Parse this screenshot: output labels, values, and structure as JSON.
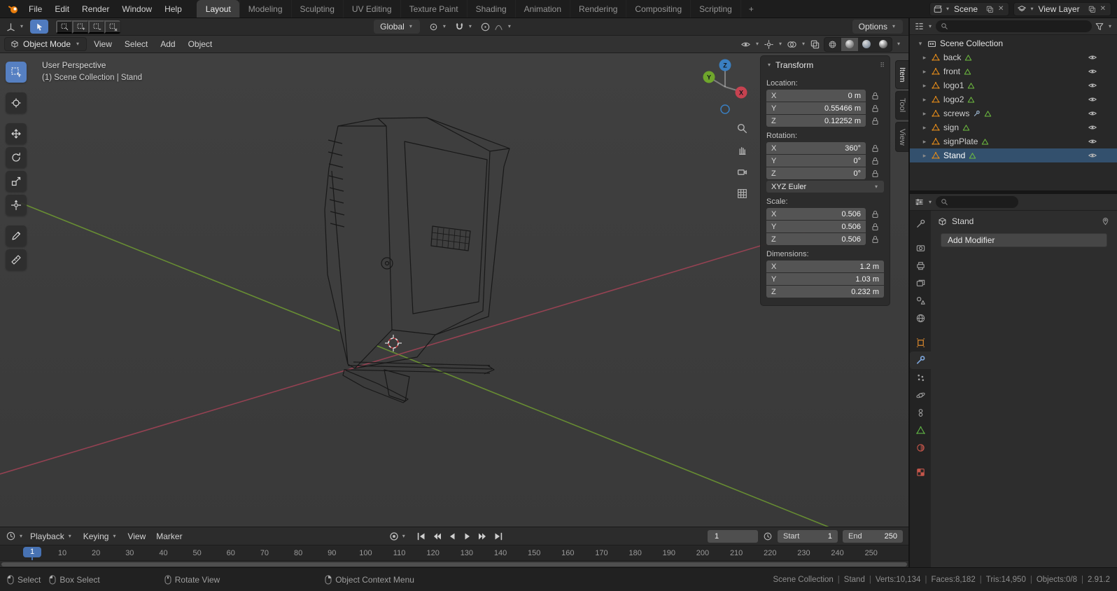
{
  "icons": {
    "chevron": "▾",
    "disclosure": "▸",
    "grip": "⠿",
    "close": "✕"
  },
  "topbar": {
    "menus": [
      {
        "label": "File"
      },
      {
        "label": "Edit"
      },
      {
        "label": "Render"
      },
      {
        "label": "Window"
      },
      {
        "label": "Help"
      }
    ],
    "workspaces": [
      {
        "label": "Layout",
        "class": "active"
      },
      {
        "label": "Modeling"
      },
      {
        "label": "Sculpting"
      },
      {
        "label": "UV Editing"
      },
      {
        "label": "Texture Paint"
      },
      {
        "label": "Shading"
      },
      {
        "label": "Animation"
      },
      {
        "label": "Rendering"
      },
      {
        "label": "Compositing"
      },
      {
        "label": "Scripting"
      }
    ],
    "add_workspace": "+",
    "scene": "Scene",
    "view_layer": "View Layer"
  },
  "tool_settings": {
    "orientation": "Global",
    "options": "Options"
  },
  "viewport_header": {
    "mode": "Object Mode",
    "menus": [
      {
        "label": "View"
      },
      {
        "label": "Select"
      },
      {
        "label": "Add"
      },
      {
        "label": "Object"
      }
    ]
  },
  "viewport": {
    "view_label": "User Perspective",
    "context_label": "(1) Scene Collection | Stand",
    "gizmo": {
      "x": "X",
      "y": "Y",
      "z": "Z"
    }
  },
  "toolbar": {
    "tools": [
      "Select Box",
      "Cursor",
      "Move",
      "Rotate",
      "Scale",
      "Transform",
      "Annotate",
      "Measure"
    ],
    "active_tool": "Select Box"
  },
  "npanel": {
    "tabs": [
      {
        "label": "Item",
        "class": "active"
      },
      {
        "label": "Tool"
      },
      {
        "label": "View"
      }
    ],
    "title": "Transform",
    "location": {
      "label": "Location:",
      "rows": [
        {
          "axis": "X",
          "value": "0 m"
        },
        {
          "axis": "Y",
          "value": "0.55466 m"
        },
        {
          "axis": "Z",
          "value": "0.12252 m"
        }
      ]
    },
    "rotation": {
      "label": "Rotation:",
      "rows": [
        {
          "axis": "X",
          "value": "360°"
        },
        {
          "axis": "Y",
          "value": "0°"
        },
        {
          "axis": "Z",
          "value": "0°"
        }
      ]
    },
    "rotation_mode": "XYZ Euler",
    "scale": {
      "label": "Scale:",
      "rows": [
        {
          "axis": "X",
          "value": "0.506"
        },
        {
          "axis": "Y",
          "value": "0.506"
        },
        {
          "axis": "Z",
          "value": "0.506"
        }
      ]
    },
    "dimensions": {
      "label": "Dimensions:",
      "rows": [
        {
          "axis": "X",
          "value": "1.2 m"
        },
        {
          "axis": "Y",
          "value": "1.03 m"
        },
        {
          "axis": "Z",
          "value": "0.232 m"
        }
      ]
    }
  },
  "outliner": {
    "root": "Scene Collection",
    "items": [
      {
        "name": "back"
      },
      {
        "name": "front"
      },
      {
        "name": "logo1"
      },
      {
        "name": "logo2"
      },
      {
        "name": "screws",
        "class": "has-modifier"
      },
      {
        "name": "sign"
      },
      {
        "name": "signPlate"
      },
      {
        "name": "Stand",
        "class": "selected"
      }
    ]
  },
  "properties": {
    "tabs": [
      "Tool",
      "Render",
      "Output",
      "View Layer",
      "Scene",
      "World",
      "Object",
      "Modifiers",
      "Particles",
      "Physics",
      "Object Constraints",
      "Object Data",
      "Material",
      "Texture"
    ],
    "active_tab": "Modifiers",
    "breadcrumb": "Stand",
    "add_modifier": "Add Modifier"
  },
  "timeline": {
    "playback": "Playback",
    "keying": "Keying",
    "menus": [
      {
        "label": "View"
      },
      {
        "label": "Marker"
      }
    ],
    "current_frame": "1",
    "playhead_frame": "1",
    "start_label": "Start",
    "start_value": "1",
    "end_label": "End",
    "end_value": "250",
    "ticks": [
      "10",
      "20",
      "30",
      "40",
      "50",
      "60",
      "70",
      "80",
      "90",
      "100",
      "110",
      "120",
      "130",
      "140",
      "150",
      "160",
      "170",
      "180",
      "190",
      "200",
      "210",
      "220",
      "230",
      "240",
      "250"
    ]
  },
  "statusbar": {
    "hints": [
      {
        "label": "Select",
        "class": "lmb"
      },
      {
        "label": "Box Select",
        "class": "lmb"
      },
      {
        "label": "Rotate View",
        "class": "mmb"
      },
      {
        "label": "Object Context Menu",
        "class": "rmb"
      }
    ],
    "stats": [
      "Scene Collection",
      "Stand",
      "Verts:10,134",
      "Faces:8,182",
      "Tris:14,950",
      "Objects:0/8",
      "2.91.2"
    ]
  },
  "colors": {
    "accent": "#4772b3",
    "object_orange": "#e0891a",
    "mesh_green": "#6fbf3f",
    "axis_red": "#b3445a",
    "axis_green": "#76a830",
    "axis_blue": "#3a7fc1"
  }
}
